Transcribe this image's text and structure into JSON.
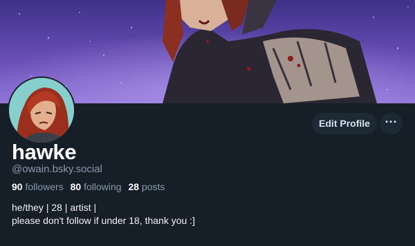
{
  "profile": {
    "display_name": "hawke",
    "handle": "@owain.bsky.social",
    "stats": {
      "followers_count": "90",
      "followers_label": "followers",
      "following_count": "80",
      "following_label": "following",
      "posts_count": "28",
      "posts_label": "posts"
    },
    "bio": [
      "he/they | 28 | artist |",
      "please don't follow if under 18, thank you :]"
    ]
  },
  "actions": {
    "edit_profile_label": "Edit Profile",
    "more_label": "···"
  },
  "icons": {
    "more": "more-options-icon"
  },
  "colors": {
    "background": "#161e27",
    "button_bg": "#1e2936",
    "muted_text": "#8a9aad",
    "banner_accent": "#6a4fb2"
  }
}
